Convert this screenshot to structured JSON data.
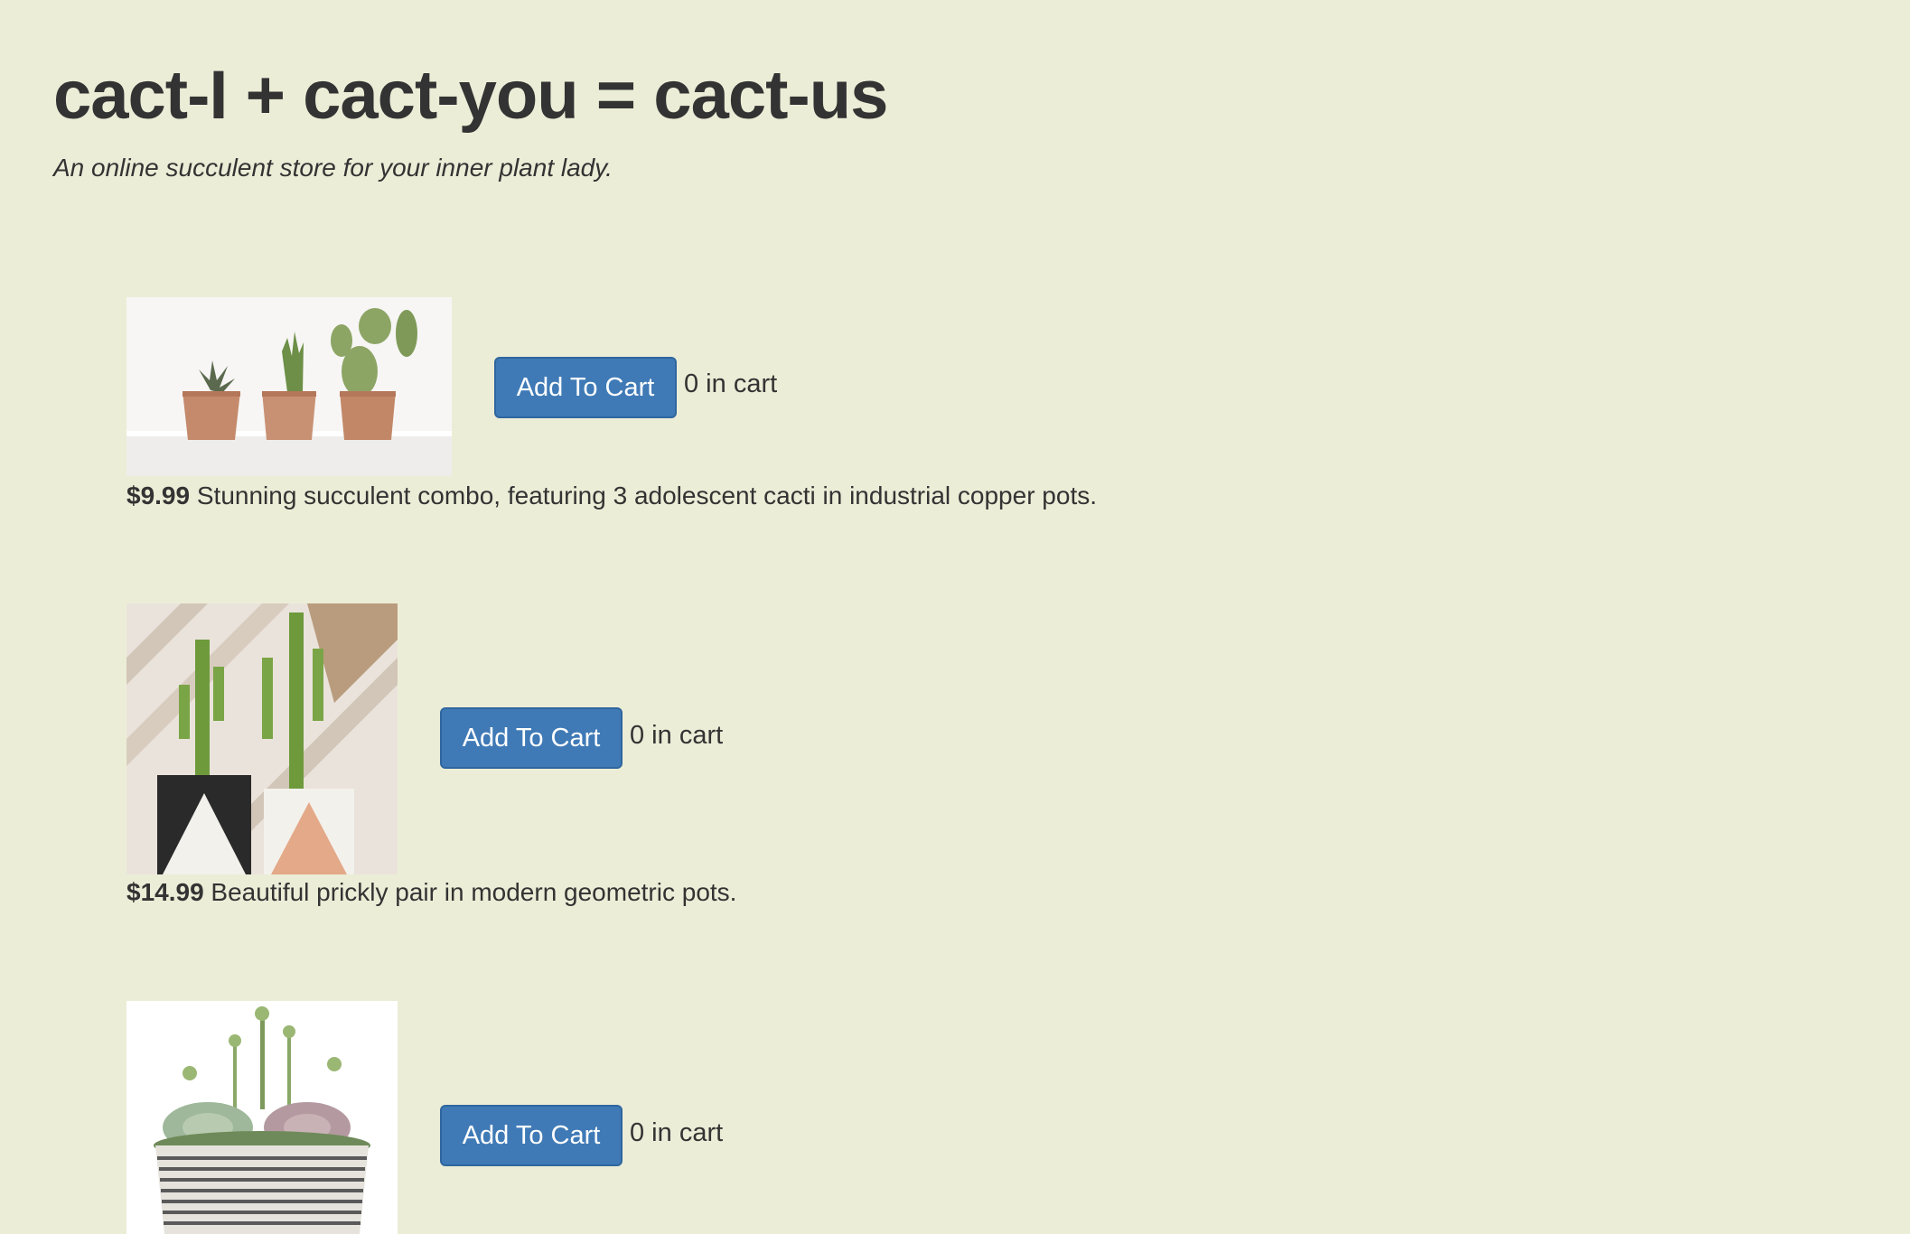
{
  "header": {
    "title": "cact-I + cact-you = cact-us",
    "tagline": "An online succulent store for your inner plant lady."
  },
  "colors": {
    "background": "#ecedd7",
    "button": "#3f7ab6",
    "text": "#333333"
  },
  "products": [
    {
      "image_icon": "copper-pots-cacti-image",
      "button_label": "Add To Cart",
      "cart_count": "0 in cart",
      "price": "$9.99",
      "description": "Stunning succulent combo, featuring 3 adolescent cacti in industrial copper pots."
    },
    {
      "image_icon": "geometric-pots-cacti-image",
      "button_label": "Add To Cart",
      "cart_count": "0 in cart",
      "price": "$14.99",
      "description": "Beautiful prickly pair in modern geometric pots."
    },
    {
      "image_icon": "succulent-bowl-image",
      "button_label": "Add To Cart",
      "cart_count": "0 in cart"
    }
  ]
}
